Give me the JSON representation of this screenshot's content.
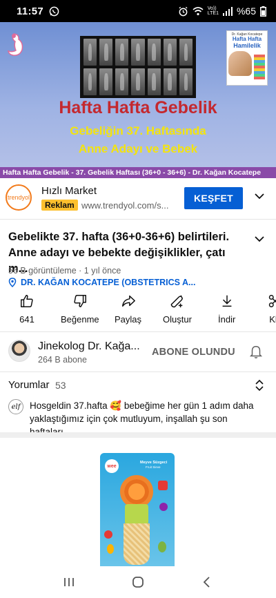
{
  "status_bar": {
    "time": "11:57",
    "network_label": "Vo))\nLTE1",
    "battery": "%65"
  },
  "video": {
    "title": "Hafta Hafta Gebelik",
    "subtitle_line1": "Gebeliğin 37. Haftasında",
    "subtitle_line2": "Anne Adayı ve Bebek",
    "caption": "Hafta Hafta Gebelik - 37. Gebelik Haftası (36+0 - 36+6) - Dr. Kağan Kocatepe",
    "book": {
      "top_text": "Dr. Kağan Kocatepe",
      "title_line1": "Hafta Hafta",
      "title_line2": "Hamilelik"
    }
  },
  "ad": {
    "advertiser_logo_text": "trendyol",
    "title": "Hızlı Market",
    "badge": "Reklam",
    "url": "www.trendyol.com/s...",
    "cta": "KEŞFET"
  },
  "info": {
    "title": "Gebelikte 37. hafta (36+0-36+6) belirtileri. Anne adayı ve bebekte değişiklikler, çatı m...",
    "meta": "56 B görüntüleme · 1 yıl önce",
    "location": "DR. KAĞAN KOCATEPE (OBSTETRICS A..."
  },
  "actions": [
    {
      "label": "641",
      "icon": "like-icon"
    },
    {
      "label": "Beğenme",
      "icon": "dislike-icon"
    },
    {
      "label": "Paylaş",
      "icon": "share-icon"
    },
    {
      "label": "Oluştur",
      "icon": "create-icon"
    },
    {
      "label": "İndir",
      "icon": "download-icon"
    },
    {
      "label": "Kl",
      "icon": "clip-icon"
    }
  ],
  "channel": {
    "name": "Jinekolog Dr. Kağa...",
    "subscribers": "264 B abone",
    "subscribe_label": "ABONE OLUNDU"
  },
  "comments": {
    "label": "Yorumlar",
    "count": "53",
    "top_comment_avatar": "elf",
    "top_comment": "Hosgeldin 37.hafta 🥰 bebeğime her gün 1 adım daha yaklaştığımız için çok mutluyum, inşallah şu son haftaları..."
  },
  "product": {
    "brand": "wee",
    "name": "Meyve Süzgeci",
    "name_en": "Fruit Sieve"
  },
  "colors": {
    "accent_blue": "#065fd4",
    "ad_badge": "#fcc02e",
    "video_title": "#c4282e",
    "video_subtitle": "#f4e40c",
    "caption_bg": "#8a4aa8"
  }
}
